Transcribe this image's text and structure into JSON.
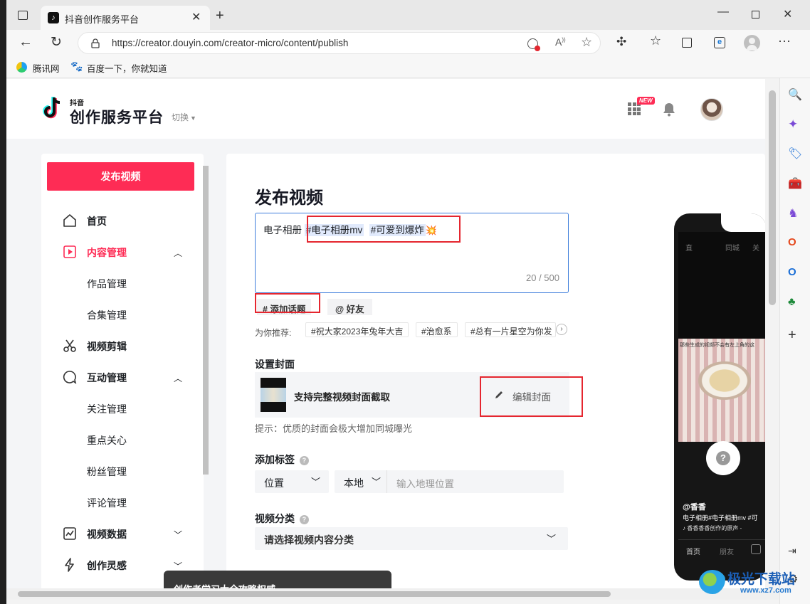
{
  "browser": {
    "tab_title": "抖音创作服务平台",
    "url": "https://creator.douyin.com/creator-micro/content/publish",
    "bookmarks": [
      "腾讯网",
      "百度一下，你就知道"
    ]
  },
  "header": {
    "logo_small": "抖音",
    "logo_title": "创作服务平台",
    "switch_label": "切换",
    "new_badge": "NEW"
  },
  "nav": {
    "publish_button": "发布视频",
    "items": [
      "首页",
      "内容管理",
      "作品管理",
      "合集管理",
      "视频剪辑",
      "互动管理",
      "关注管理",
      "重点关心",
      "粉丝管理",
      "评论管理",
      "视频数据",
      "创作灵感"
    ]
  },
  "main": {
    "page_title": "发布视频",
    "desc_prefix": "电子相册",
    "desc_tags": [
      "#电子相册mv",
      "#可爱到爆炸"
    ],
    "counter": "20 / 500",
    "add_topic": "# 添加话题",
    "mention_friend": "@ 好友",
    "recommend_label": "为你推荐:",
    "recommend_chips": [
      "#祝大家2023年兔年大吉",
      "#治愈系",
      "#总有一片星空为你发"
    ],
    "cover_section": "设置封面",
    "cover_support": "支持完整视频封面截取",
    "edit_cover": "编辑封面",
    "cover_tip": "提示：优质的封面会极大增加同城曝光",
    "tag_section": "添加标签",
    "location_select": "位置",
    "local_select": "本地",
    "location_placeholder": "输入地理位置",
    "category_section": "视频分类",
    "category_placeholder": "请选择视频内容分类",
    "toast": "创作者学习大全攻略权威"
  },
  "phone": {
    "tabs": [
      "同城",
      "关"
    ],
    "video_caption": "那些生成的视频不会有左上角的这",
    "username": "@香香",
    "caption": "电子相册#电子相册mv #可",
    "music": "香香香香创作的原声 -",
    "bottom_nav": [
      "首页",
      "朋友"
    ]
  },
  "watermark": {
    "brand": "极光下载站",
    "site": "www.xz7.com"
  },
  "colors": {
    "accent": "#fe2c55",
    "annotation_red": "#e5262f",
    "tag_highlight": "#e1eafc"
  }
}
